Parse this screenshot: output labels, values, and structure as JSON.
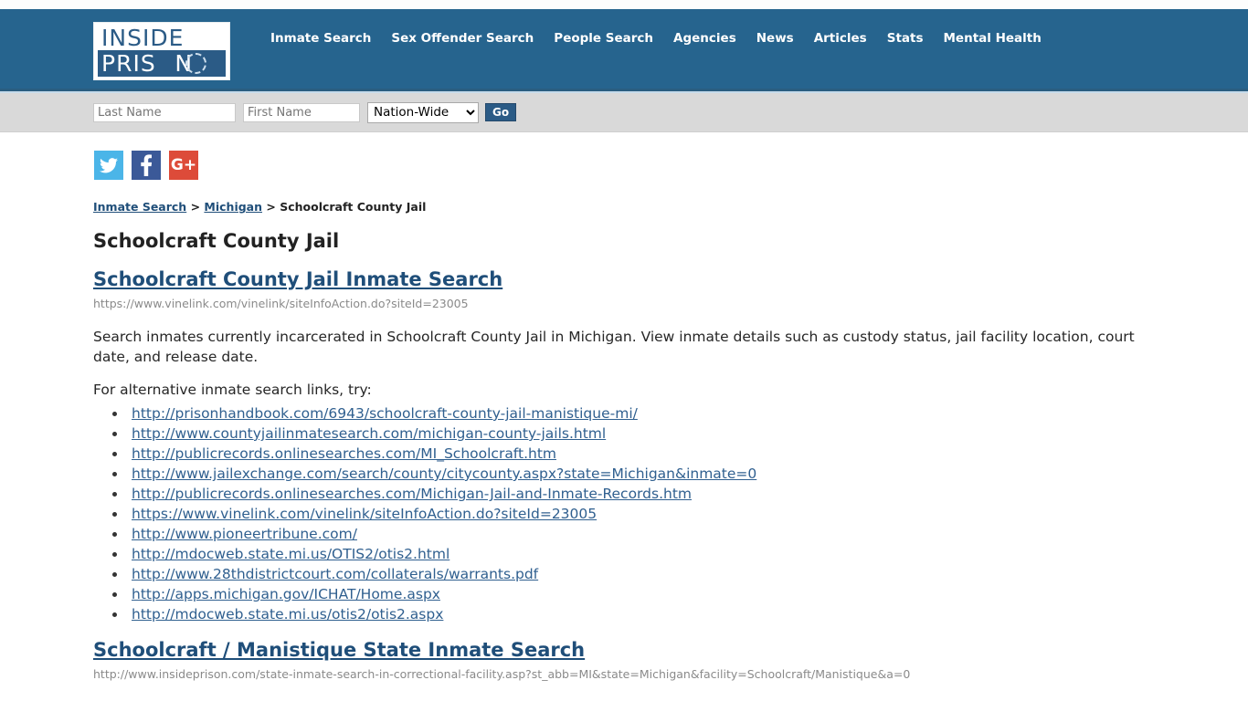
{
  "header": {
    "logo": {
      "line1": "INSIDE",
      "line2_prefix": "PRIS",
      "line2_o": "O",
      "line2_suffix": "N",
      "background": "#2b5b86"
    },
    "nav": [
      {
        "label": "Inmate Search"
      },
      {
        "label": "Sex Offender Search"
      },
      {
        "label": "People Search"
      },
      {
        "label": "Agencies"
      },
      {
        "label": "News"
      },
      {
        "label": "Articles"
      },
      {
        "label": "Stats"
      },
      {
        "label": "Mental Health"
      }
    ],
    "background": "#26648e"
  },
  "search": {
    "last_name_placeholder": "Last Name",
    "last_name_value": "",
    "first_name_placeholder": "First Name",
    "first_name_value": "",
    "state_selected": "Nation-Wide",
    "state_options": [
      "Nation-Wide"
    ],
    "go_label": "Go"
  },
  "social": [
    {
      "name": "twitter",
      "color": "#4bb5e8"
    },
    {
      "name": "facebook",
      "color": "#3b5998"
    },
    {
      "name": "google-plus",
      "color": "#dd4b39",
      "glyph": "G+"
    }
  ],
  "breadcrumb": {
    "item1": "Inmate Search",
    "sep1": " > ",
    "item2": "Michigan",
    "sep2": " > ",
    "current": "Schoolcraft County Jail"
  },
  "page": {
    "title": "Schoolcraft County Jail"
  },
  "sections": [
    {
      "heading": "Schoolcraft County Jail Inmate Search",
      "url": "https://www.vinelink.com/vinelink/siteInfoAction.do?siteId=23005",
      "description": "Search inmates currently incarcerated in Schoolcraft County Jail in Michigan. View inmate details such as custody status, jail facility location, court date, and release date.",
      "alt_intro": "For alternative inmate search links, try:",
      "links": [
        "http://prisonhandbook.com/6943/schoolcraft-county-jail-manistique-mi/",
        "http://www.countyjailinmatesearch.com/michigan-county-jails.html",
        "http://publicrecords.onlinesearches.com/MI_Schoolcraft.htm",
        "http://www.jailexchange.com/search/county/citycounty.aspx?state=Michigan&inmate=0",
        "http://publicrecords.onlinesearches.com/Michigan-Jail-and-Inmate-Records.htm",
        "https://www.vinelink.com/vinelink/siteInfoAction.do?siteId=23005",
        "http://www.pioneertribune.com/",
        "http://mdocweb.state.mi.us/OTIS2/otis2.html",
        "http://www.28thdistrictcourt.com/collaterals/warrants.pdf",
        "http://apps.michigan.gov/ICHAT/Home.aspx",
        "http://mdocweb.state.mi.us/otis2/otis2.aspx"
      ]
    },
    {
      "heading": "Schoolcraft / Manistique State Inmate Search",
      "url": "http://www.insideprison.com/state-inmate-search-in-correctional-facility.asp?st_abb=MI&state=Michigan&facility=Schoolcraft/Manistique&a=0"
    }
  ]
}
